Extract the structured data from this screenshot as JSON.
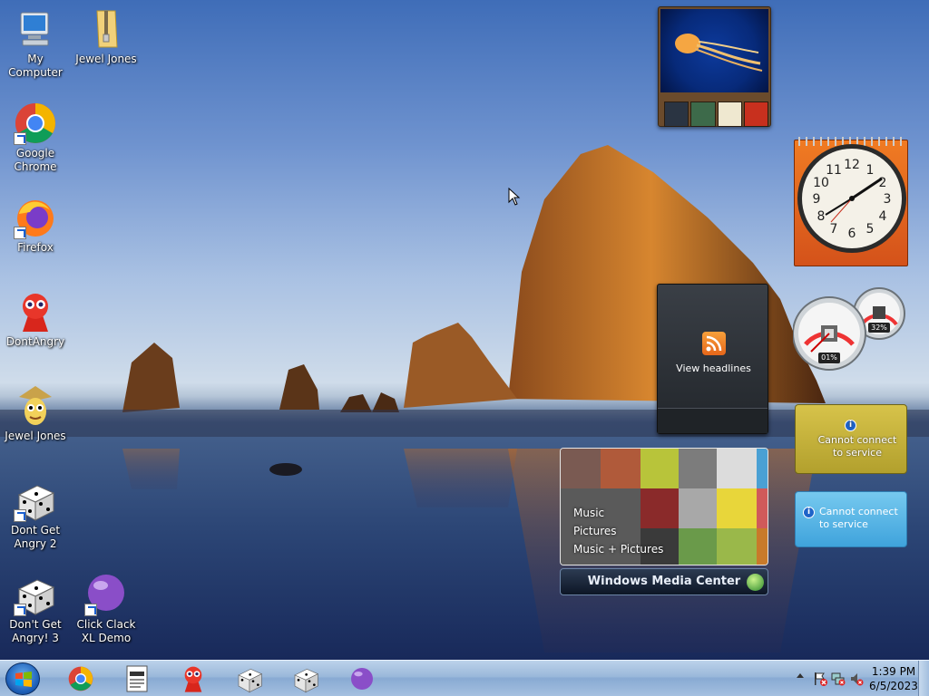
{
  "desktop": {
    "icons": [
      {
        "label": "My Computer",
        "icon": "computer-icon"
      },
      {
        "label": "Jewel Jones",
        "icon": "zip-folder-icon"
      },
      {
        "label": "Google Chrome",
        "icon": "chrome-icon",
        "shortcut": true
      },
      {
        "label": "Firefox",
        "icon": "firefox-icon",
        "shortcut": true
      },
      {
        "label": "DontAngry",
        "icon": "red-figure-icon"
      },
      {
        "label": "Jewel Jones",
        "icon": "jewel-jones-icon"
      },
      {
        "label": "Dont Get Angry 2",
        "icon": "dice-icon",
        "shortcut": true
      },
      {
        "label": "Don't Get Angry! 3",
        "icon": "dice-icon",
        "shortcut": true
      },
      {
        "label": "Click Clack XL Demo",
        "icon": "purple-ball-icon",
        "shortcut": true
      }
    ]
  },
  "gadgets": {
    "feed": {
      "label": "View headlines"
    },
    "weather": {
      "message": "Cannot connect to service"
    },
    "stocks": {
      "message": "Cannot connect to service"
    },
    "cpu_meter": {
      "cpu": "01%",
      "memory": "32%"
    },
    "media_center": {
      "menu": [
        "Music",
        "Pictures",
        "Music + Pictures"
      ],
      "title": "Windows Media Center"
    },
    "clock": {
      "numbers": [
        "12",
        "1",
        "2",
        "3",
        "4",
        "5",
        "6",
        "7",
        "8",
        "9",
        "10",
        "11"
      ]
    }
  },
  "taskbar": {
    "pinned": [
      "chrome-icon",
      "document-icon",
      "red-figure-icon",
      "dice-icon",
      "dice-icon",
      "purple-ball-icon"
    ],
    "time": "1:39 PM",
    "date": "6/5/2023"
  },
  "colors": {
    "taskbar": "#9ab8da",
    "clock_gadget": "#f07b23",
    "weather_gadget": "#d7c34a",
    "stock_gadget": "#76c9ef"
  }
}
